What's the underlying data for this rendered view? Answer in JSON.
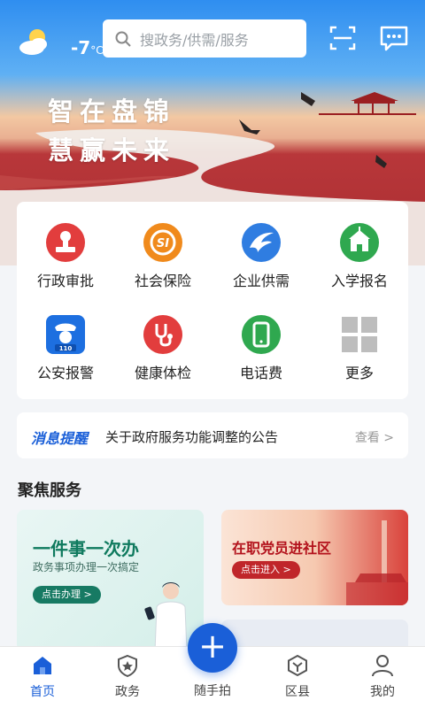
{
  "header": {
    "temperature": "-7",
    "temperature_unit": "°C",
    "search_placeholder": "搜政务/供需/服务",
    "weather_icon": "partly-cloudy-icon",
    "scan_icon": "scan-icon",
    "message_icon": "chat-icon"
  },
  "hero": {
    "slogan_line1": "智在盘锦",
    "slogan_line2": "慧赢未来"
  },
  "services": [
    {
      "label": "行政审批",
      "icon": "stamp-icon",
      "color": "#e03b3b"
    },
    {
      "label": "社会保险",
      "icon": "social-security-icon",
      "color": "#f08a1c"
    },
    {
      "label": "企业供需",
      "icon": "eagle-icon",
      "color": "#2f7de1"
    },
    {
      "label": "入学报名",
      "icon": "school-icon",
      "color": "#2fa84f"
    },
    {
      "label": "公安报警",
      "icon": "police-icon",
      "color": "#1d6fe0"
    },
    {
      "label": "健康体检",
      "icon": "stethoscope-icon",
      "color": "#e03b3b"
    },
    {
      "label": "电话费",
      "icon": "phone-icon",
      "color": "#2fa84f"
    },
    {
      "label": "更多",
      "icon": "grid-icon",
      "color": "#bdbdbd"
    }
  ],
  "notice": {
    "tag": "消息提醒",
    "text": "关于政府服务功能调整的公告",
    "more": "查看 >"
  },
  "focus": {
    "title": "聚焦服务",
    "card1_title": "一件事一次办",
    "card1_subtitle": "政务事项办理一次搞定",
    "card1_button": "点击办理 >",
    "card2_title": "在职党员进社区",
    "card2_button": "点击进入 >"
  },
  "tabbar": [
    {
      "label": "首页",
      "icon": "home-icon",
      "active": true
    },
    {
      "label": "政务",
      "icon": "shield-star-icon",
      "active": false
    },
    {
      "label": "随手拍",
      "icon": "plus-icon",
      "active": false
    },
    {
      "label": "区县",
      "icon": "hexagon-icon",
      "active": false
    },
    {
      "label": "我的",
      "icon": "user-icon",
      "active": false
    }
  ],
  "colors": {
    "accent": "#1a5fd8"
  }
}
